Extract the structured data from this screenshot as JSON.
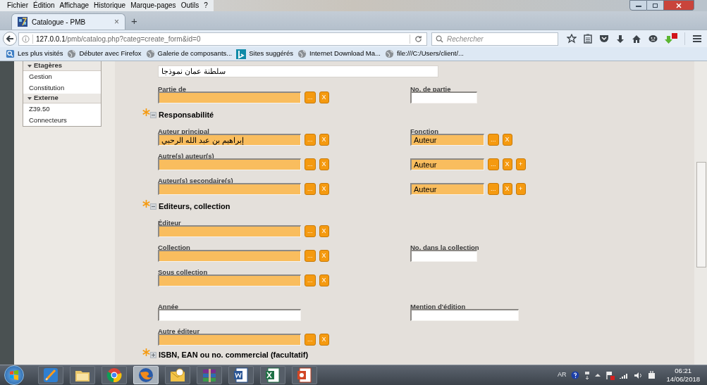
{
  "menu_bar": [
    "Fichier",
    "Édition",
    "Affichage",
    "Historique",
    "Marque-pages",
    "Outils",
    "?"
  ],
  "tabs": [
    {
      "label": "Catalogue - PMB",
      "selected": true,
      "close": "×"
    }
  ],
  "new_tab": "+",
  "address": {
    "url": "**127.0.0.1**/pmb/catalog.php?categ=create_form&id=0"
  },
  "search": {
    "placeholder": "Rechercher"
  },
  "bookmarks": [
    {
      "kind": "pinned",
      "label": "Les plus visités"
    },
    {
      "kind": "globe",
      "label": "Débuter avec Firefox"
    },
    {
      "kind": "globe",
      "label": "Galerie de composants..."
    },
    {
      "kind": "tile",
      "label": "Sites suggérés"
    },
    {
      "kind": "globe",
      "label": "Internet Download Ma..."
    },
    {
      "kind": "globe",
      "label": "file:///C:/Users/client/..."
    }
  ],
  "sidebar": [
    {
      "title": "Etagères",
      "expanded": true,
      "items": [
        "Gestion",
        "Constitution"
      ]
    },
    {
      "title": "Externe",
      "expanded": true,
      "items": [
        "Z39.50",
        "Connecteurs"
      ]
    }
  ],
  "form": [
    {
      "kind": "wide",
      "value": "سلطنة عمان نموذجا"
    },
    {
      "kind": "row",
      "left": {
        "label": "Partie de",
        "kind": "lookup",
        "buttons": [
          "...",
          "X"
        ]
      },
      "right": {
        "label": "No. de partie",
        "kind": "number"
      }
    },
    {
      "kind": "section",
      "title": "Responsabilité",
      "expanded": true
    },
    {
      "kind": "row",
      "left": {
        "label": "Auteur principal",
        "kind": "lookup",
        "value": "إبراهيم بن عبد الله الرحبي",
        "buttons": [
          "...",
          "X"
        ]
      },
      "right": {
        "label": "Fonction",
        "kind": "lookup",
        "value": "Auteur",
        "buttons": [
          "...",
          "X"
        ]
      }
    },
    {
      "kind": "row",
      "left": {
        "label": "Autre(s) auteur(s)",
        "kind": "lookup",
        "buttons": [
          "...",
          "X"
        ]
      },
      "right": {
        "kind": "lookup",
        "value": "Auteur",
        "buttons": [
          "...",
          "X",
          "+"
        ]
      }
    },
    {
      "kind": "row",
      "left": {
        "label": "Auteur(s) secondaire(s)",
        "kind": "lookup",
        "buttons": [
          "...",
          "X"
        ]
      },
      "right": {
        "kind": "lookup",
        "value": "Auteur",
        "buttons": [
          "...",
          "X",
          "+"
        ]
      }
    },
    {
      "kind": "section",
      "title": "Editeurs, collection",
      "expanded": true
    },
    {
      "kind": "row",
      "left": {
        "label": "Éditeur",
        "kind": "lookup",
        "buttons": [
          "...",
          "X"
        ]
      }
    },
    {
      "kind": "row",
      "left": {
        "label": "Collection",
        "kind": "lookup",
        "buttons": [
          "...",
          "X"
        ]
      },
      "right": {
        "label": "No. dans la collection",
        "kind": "number"
      }
    },
    {
      "kind": "row",
      "left": {
        "label": "Sous collection",
        "kind": "lookup",
        "buttons": [
          "...",
          "X"
        ]
      }
    },
    {
      "kind": "gap"
    },
    {
      "kind": "row",
      "left": {
        "label": "Année",
        "kind": "text"
      },
      "right": {
        "label": "Mention d'édition",
        "kind": "text"
      }
    },
    {
      "kind": "row",
      "left": {
        "label": "Autre éditeur",
        "kind": "lookup",
        "buttons": [
          "...",
          "X"
        ]
      }
    },
    {
      "kind": "section",
      "title": "ISBN, EAN ou no. commercial (facultatif)",
      "expanded": false
    }
  ],
  "taskbar": [
    {
      "kind": "paint",
      "selected": false
    },
    {
      "kind": "folder",
      "selected": false
    },
    {
      "kind": "chrome",
      "selected": false
    },
    {
      "kind": "fox",
      "selected": true
    },
    {
      "kind": "mail",
      "selected": false
    },
    {
      "kind": "archive",
      "selected": false
    },
    {
      "kind": "doc",
      "selected": false
    },
    {
      "kind": "sheet",
      "selected": false
    },
    {
      "kind": "slides",
      "selected": false
    }
  ],
  "tray": {
    "language": "AR",
    "time": "06:21",
    "date": "14/06/2018"
  }
}
